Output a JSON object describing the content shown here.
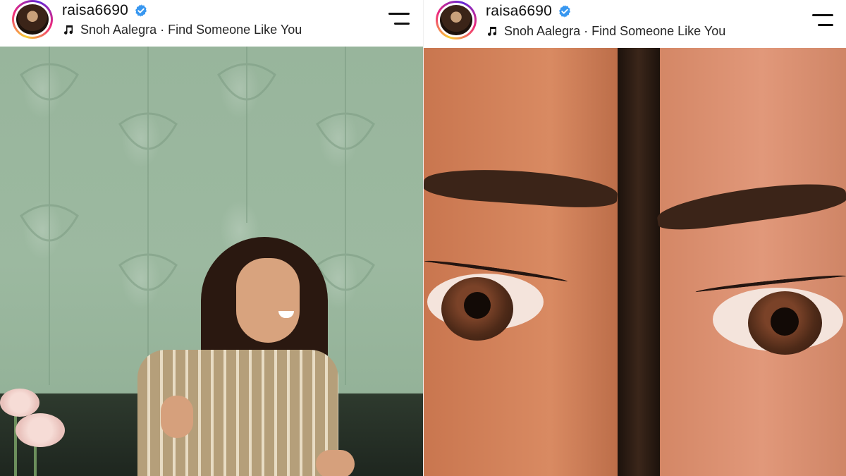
{
  "posts": [
    {
      "username": "raisa6690",
      "verified": true,
      "song": "Snoh Aalegra · Find Someone Like You",
      "photo": "woman-laughing-green-wall"
    },
    {
      "username": "raisa6690",
      "verified": true,
      "song": "Snoh Aalegra · Find Someone Like You",
      "photo": "two-faces-eyes-closeup"
    }
  ],
  "icons": {
    "verified": "verified-badge-icon",
    "music": "music-note-icon",
    "menu": "menu-icon"
  },
  "colors": {
    "verified_blue": "#3897f0",
    "text": "#111111"
  }
}
